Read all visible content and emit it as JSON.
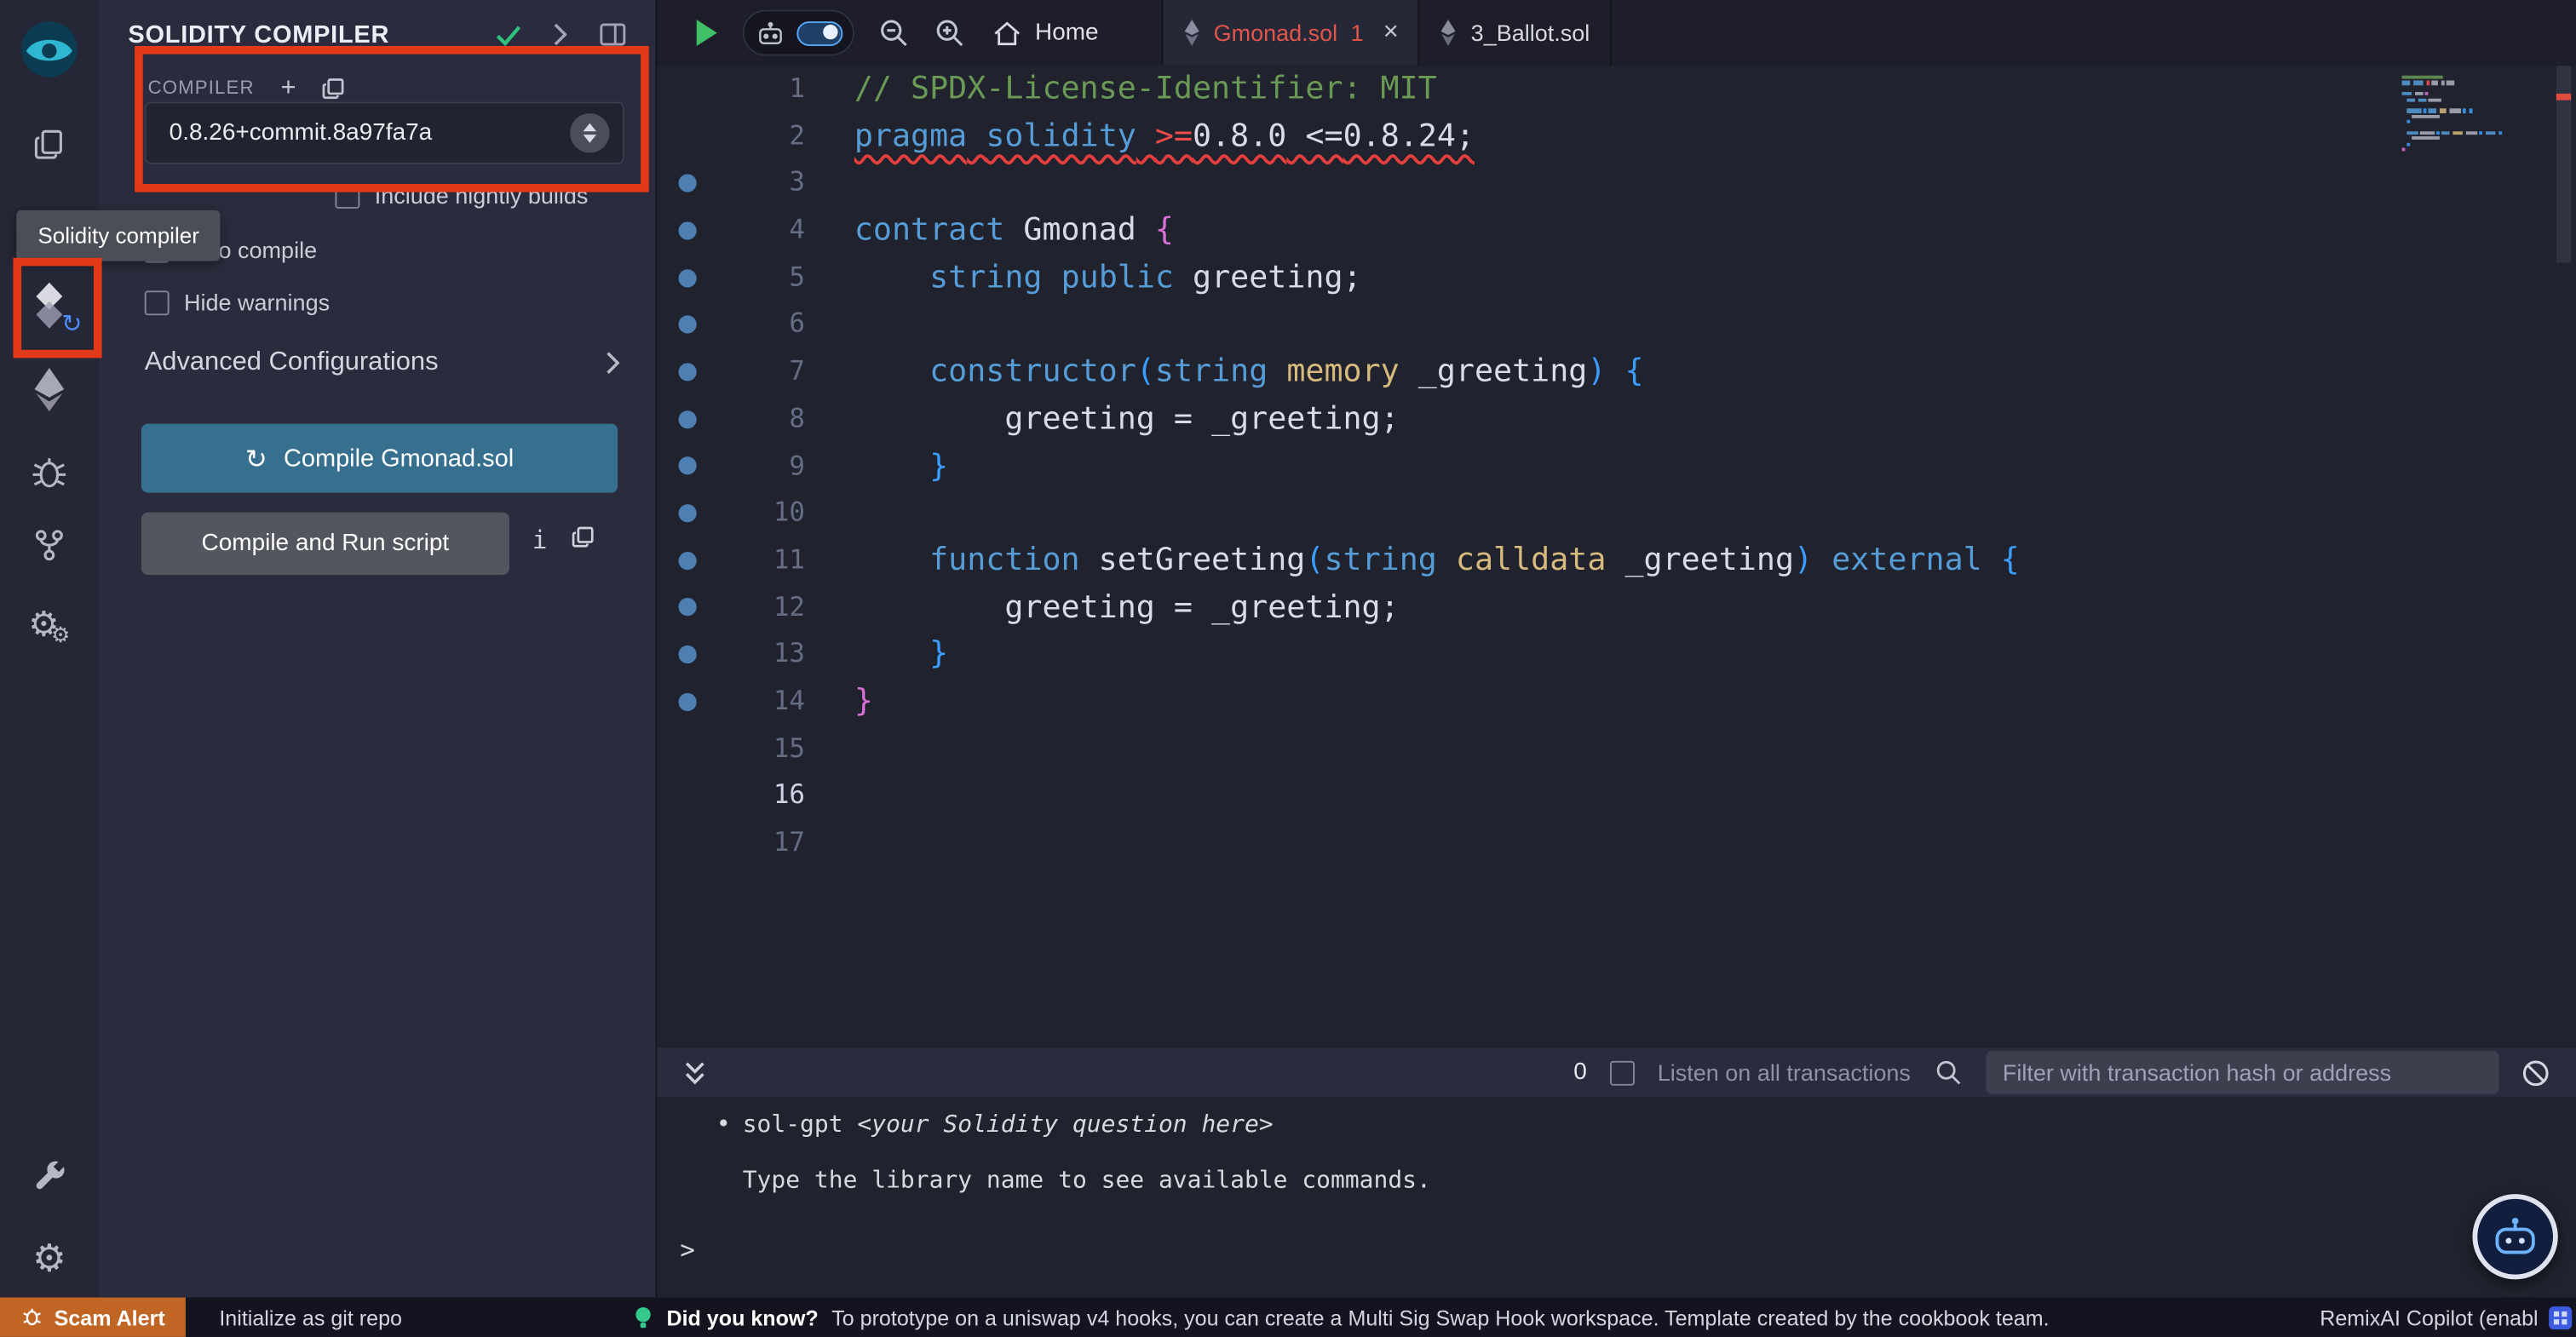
{
  "activity_bar": {
    "tooltip": "Solidity compiler",
    "icons": [
      "remix-logo",
      "file-explorer",
      "solidity-compiler",
      "deploy-and-run",
      "debugger",
      "plugin-connector",
      "settings-gears",
      "plugin-manager",
      "preferences"
    ]
  },
  "side_panel": {
    "title": "SOLIDITY COMPILER",
    "header_icons": [
      "check-icon",
      "chevron-right-icon",
      "pin-panel-icon"
    ],
    "compiler": {
      "label": "COMPILER",
      "version": "0.8.26+commit.8a97fa7a"
    },
    "options": [
      {
        "label": "Include nightly builds",
        "checked": false
      },
      {
        "label": "Auto compile",
        "checked": false
      },
      {
        "label": "Hide warnings",
        "checked": false
      }
    ],
    "advanced_label": "Advanced Configurations",
    "compile_button": "Compile Gmonad.sol",
    "compile_run_button": "Compile and Run script"
  },
  "editor": {
    "toolbar": {
      "home_label": "Home"
    },
    "tabs": [
      {
        "label": "Gmonad.sol",
        "badge": "1",
        "close": "×",
        "active": true
      },
      {
        "label": "3_Ballot.sol",
        "active": false
      }
    ],
    "lines": [
      {
        "num": 1,
        "dot": false,
        "tokens": [
          {
            "t": "// SPDX-License-Identifier: MIT",
            "c": "com"
          }
        ]
      },
      {
        "num": 2,
        "dot": false,
        "squiggle": true,
        "tokens": [
          {
            "t": "pragma",
            "c": "kw"
          },
          {
            "t": " ",
            "c": "txt"
          },
          {
            "t": "solidity",
            "c": "kw"
          },
          {
            "t": " ",
            "c": "txt"
          },
          {
            "t": ">=",
            "c": "err"
          },
          {
            "t": "0.8.0",
            "c": "txt"
          },
          {
            "t": " <=",
            "c": "txt"
          },
          {
            "t": "0.8.24;",
            "c": "txt"
          }
        ]
      },
      {
        "num": 3,
        "dot": true,
        "tokens": []
      },
      {
        "num": 4,
        "dot": true,
        "tokens": [
          {
            "t": "contract",
            "c": "kw"
          },
          {
            "t": " Gmonad ",
            "c": "txt"
          },
          {
            "t": "{",
            "c": "b1"
          }
        ]
      },
      {
        "num": 5,
        "dot": true,
        "tokens": [
          {
            "t": "    ",
            "c": "txt"
          },
          {
            "t": "string",
            "c": "kw"
          },
          {
            "t": " ",
            "c": "txt"
          },
          {
            "t": "public",
            "c": "kw"
          },
          {
            "t": " greeting;",
            "c": "txt"
          }
        ]
      },
      {
        "num": 6,
        "dot": true,
        "tokens": []
      },
      {
        "num": 7,
        "dot": true,
        "tokens": [
          {
            "t": "    ",
            "c": "txt"
          },
          {
            "t": "constructor",
            "c": "kw"
          },
          {
            "t": "(",
            "c": "b2"
          },
          {
            "t": "string",
            "c": "kw"
          },
          {
            "t": " ",
            "c": "txt"
          },
          {
            "t": "memory",
            "c": "gold"
          },
          {
            "t": " _greeting",
            "c": "txt"
          },
          {
            "t": ")",
            "c": "b2"
          },
          {
            "t": " ",
            "c": "txt"
          },
          {
            "t": "{",
            "c": "b2"
          }
        ]
      },
      {
        "num": 8,
        "dot": true,
        "tokens": [
          {
            "t": "        greeting = _greeting;",
            "c": "txt"
          }
        ]
      },
      {
        "num": 9,
        "dot": true,
        "tokens": [
          {
            "t": "    ",
            "c": "txt"
          },
          {
            "t": "}",
            "c": "b2"
          }
        ]
      },
      {
        "num": 10,
        "dot": true,
        "tokens": []
      },
      {
        "num": 11,
        "dot": true,
        "tokens": [
          {
            "t": "    ",
            "c": "txt"
          },
          {
            "t": "function",
            "c": "kw"
          },
          {
            "t": " setGreeting",
            "c": "txt"
          },
          {
            "t": "(",
            "c": "b2"
          },
          {
            "t": "string",
            "c": "kw"
          },
          {
            "t": " ",
            "c": "txt"
          },
          {
            "t": "calldata",
            "c": "gold"
          },
          {
            "t": " _greeting",
            "c": "txt"
          },
          {
            "t": ")",
            "c": "b2"
          },
          {
            "t": " ",
            "c": "txt"
          },
          {
            "t": "external",
            "c": "kw"
          },
          {
            "t": " ",
            "c": "txt"
          },
          {
            "t": "{",
            "c": "b2"
          }
        ]
      },
      {
        "num": 12,
        "dot": true,
        "tokens": [
          {
            "t": "        greeting = _greeting;",
            "c": "txt"
          }
        ]
      },
      {
        "num": 13,
        "dot": true,
        "tokens": [
          {
            "t": "    ",
            "c": "txt"
          },
          {
            "t": "}",
            "c": "b2"
          }
        ]
      },
      {
        "num": 14,
        "dot": true,
        "tokens": [
          {
            "t": "}",
            "c": "b1"
          }
        ]
      },
      {
        "num": 15,
        "dot": false,
        "tokens": []
      },
      {
        "num": 16,
        "dot": false,
        "current": true,
        "tokens": []
      },
      {
        "num": 17,
        "dot": false,
        "tokens": []
      }
    ]
  },
  "terminal": {
    "count": "0",
    "listen_label": "Listen on all transactions",
    "filter_placeholder": "Filter with transaction hash or address",
    "lines": [
      {
        "bullet": "•",
        "parts": [
          {
            "t": "sol-gpt "
          },
          {
            "t": "<your Solidity question here>",
            "italic": true
          }
        ]
      },
      {
        "parts": [
          {
            "t": "Type the library name to see available commands."
          }
        ]
      }
    ],
    "prompt": ">"
  },
  "status_bar": {
    "scam_alert": "Scam Alert",
    "git_init": "Initialize as git repo",
    "tip_title": "Did you know?",
    "tip_text": "To prototype on a uniswap v4 hooks, you can create a Multi Sig Swap Hook workspace. Template created by the cookbook team.",
    "copilot": "RemixAI Copilot (enabl"
  },
  "colors": {
    "annotation": "#e23a18",
    "compile_button_bg": "#37708f",
    "active_tab_text": "#e0564a",
    "gutter_dot": "#4d7fb2"
  }
}
